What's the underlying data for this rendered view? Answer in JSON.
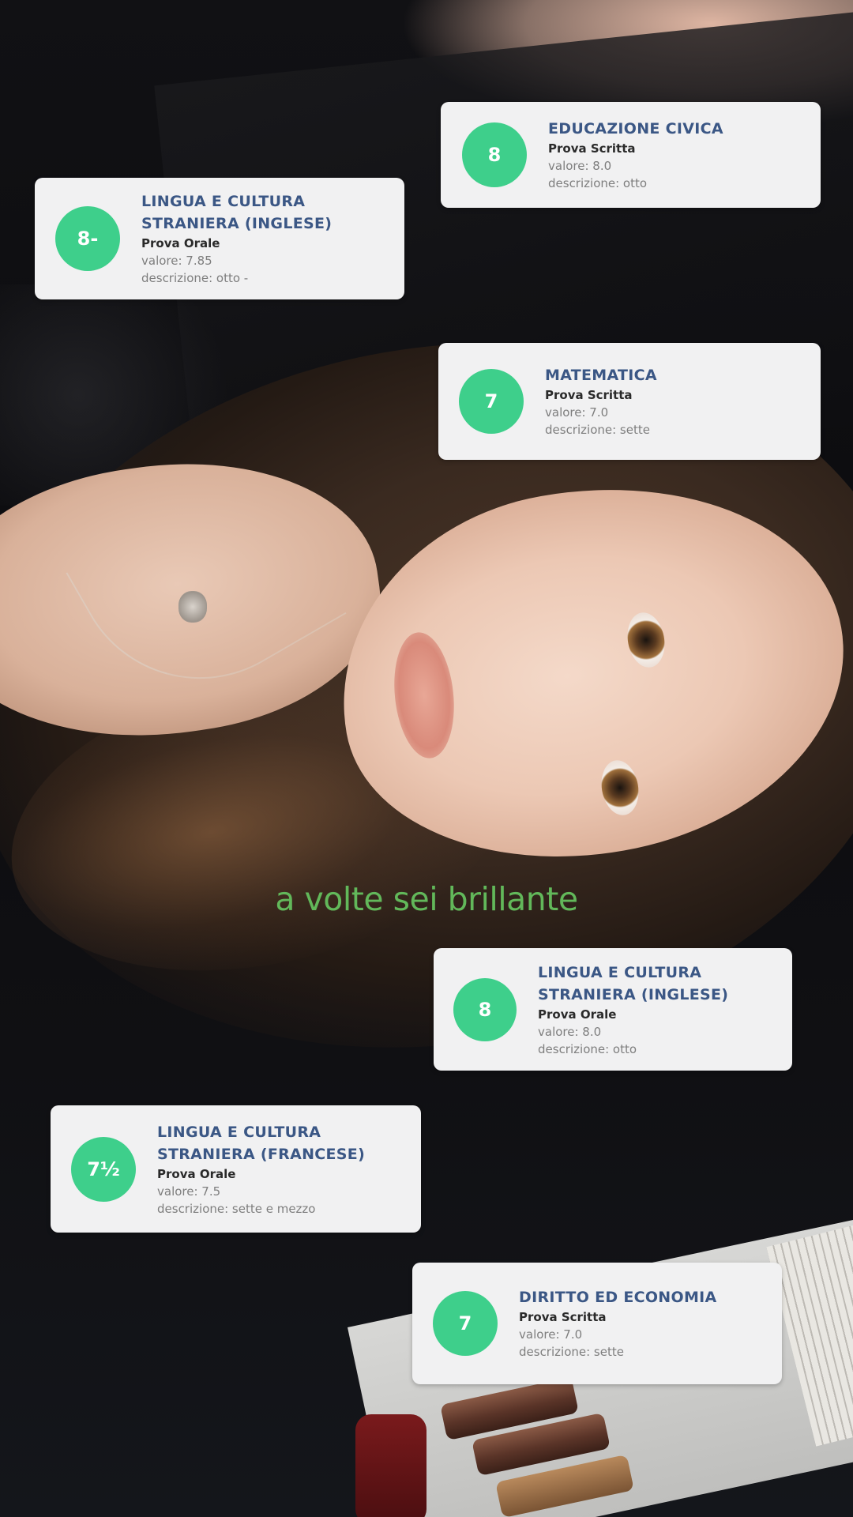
{
  "cards": [
    {
      "grade": "8",
      "subject": "EDUCAZIONE CIVICA",
      "test_type": "Prova Scritta",
      "valore": "valore: 8.0",
      "descrizione": "descrizione: otto"
    },
    {
      "grade": "8-",
      "subject": "LINGUA E CULTURA STRANIERA (INGLESE)",
      "test_type": "Prova Orale",
      "valore": "valore: 7.85",
      "descrizione": "descrizione: otto -"
    },
    {
      "grade": "7",
      "subject": "MATEMATICA",
      "test_type": "Prova Scritta",
      "valore": "valore: 7.0",
      "descrizione": "descrizione: sette"
    },
    {
      "grade": "8",
      "subject": "LINGUA E CULTURA STRANIERA (INGLESE)",
      "test_type": "Prova Orale",
      "valore": "valore: 8.0",
      "descrizione": "descrizione: otto"
    },
    {
      "grade": "7½",
      "subject": "LINGUA E CULTURA STRANIERA (FRANCESE)",
      "test_type": "Prova Orale",
      "valore": "valore: 7.5",
      "descrizione": "descrizione: sette e mezzo"
    },
    {
      "grade": "7",
      "subject": "DIRITTO ED ECONOMIA",
      "test_type": "Prova Scritta",
      "valore": "valore: 7.0",
      "descrizione": "descrizione: sette"
    }
  ],
  "caption": "a volte sei brillante",
  "colors": {
    "grade_circle": "#3ecf8b",
    "subject_text": "#3b5785",
    "card_background": "#f1f1f2",
    "caption_text": "#62b85a"
  }
}
